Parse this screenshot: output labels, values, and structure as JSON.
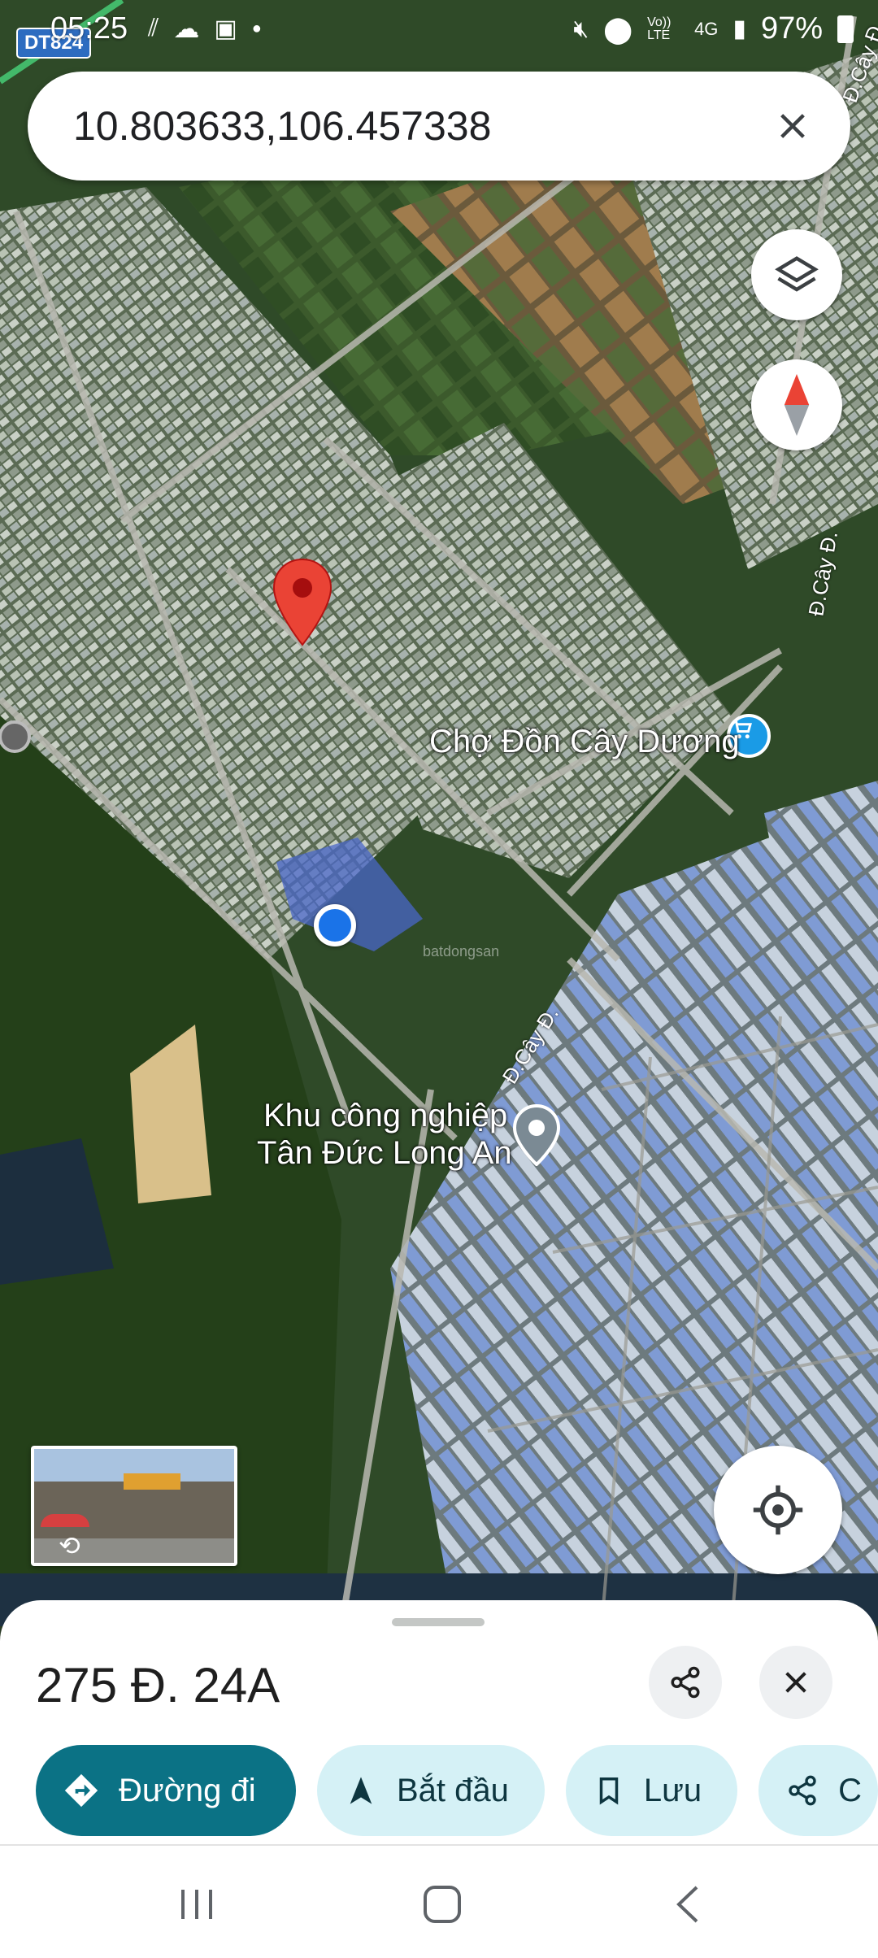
{
  "status_bar": {
    "time": "05:25",
    "battery": "97%",
    "network": "4G",
    "volte": "Vo)) LTE",
    "route_badge": "DT824"
  },
  "search": {
    "value": "10.803633,106.457338"
  },
  "map": {
    "places": [
      {
        "name": "Chợ Đồn Cây Dương"
      },
      {
        "name_line1": "Khu công nghiệp",
        "name_line2": "Tân Đức Long An"
      }
    ],
    "roads": [
      "Đ.Cây Đ.",
      "Đ.Cây Đ.",
      "Đ.Cây Đ."
    ],
    "watermark": "batdongsan"
  },
  "place_sheet": {
    "title": "275 Đ. 24A",
    "actions": [
      {
        "label": "Đường đi",
        "icon": "directions-icon"
      },
      {
        "label": "Bắt đầu",
        "icon": "navigation-arrow-icon"
      },
      {
        "label": "Lưu",
        "icon": "bookmark-icon"
      },
      {
        "label": "C",
        "icon": "share-icon"
      }
    ]
  },
  "colors": {
    "primary_chip": "#0b7285",
    "secondary_chip": "#d5f1f6",
    "pin": "#ea4335",
    "location_dot": "#1a73e8"
  }
}
